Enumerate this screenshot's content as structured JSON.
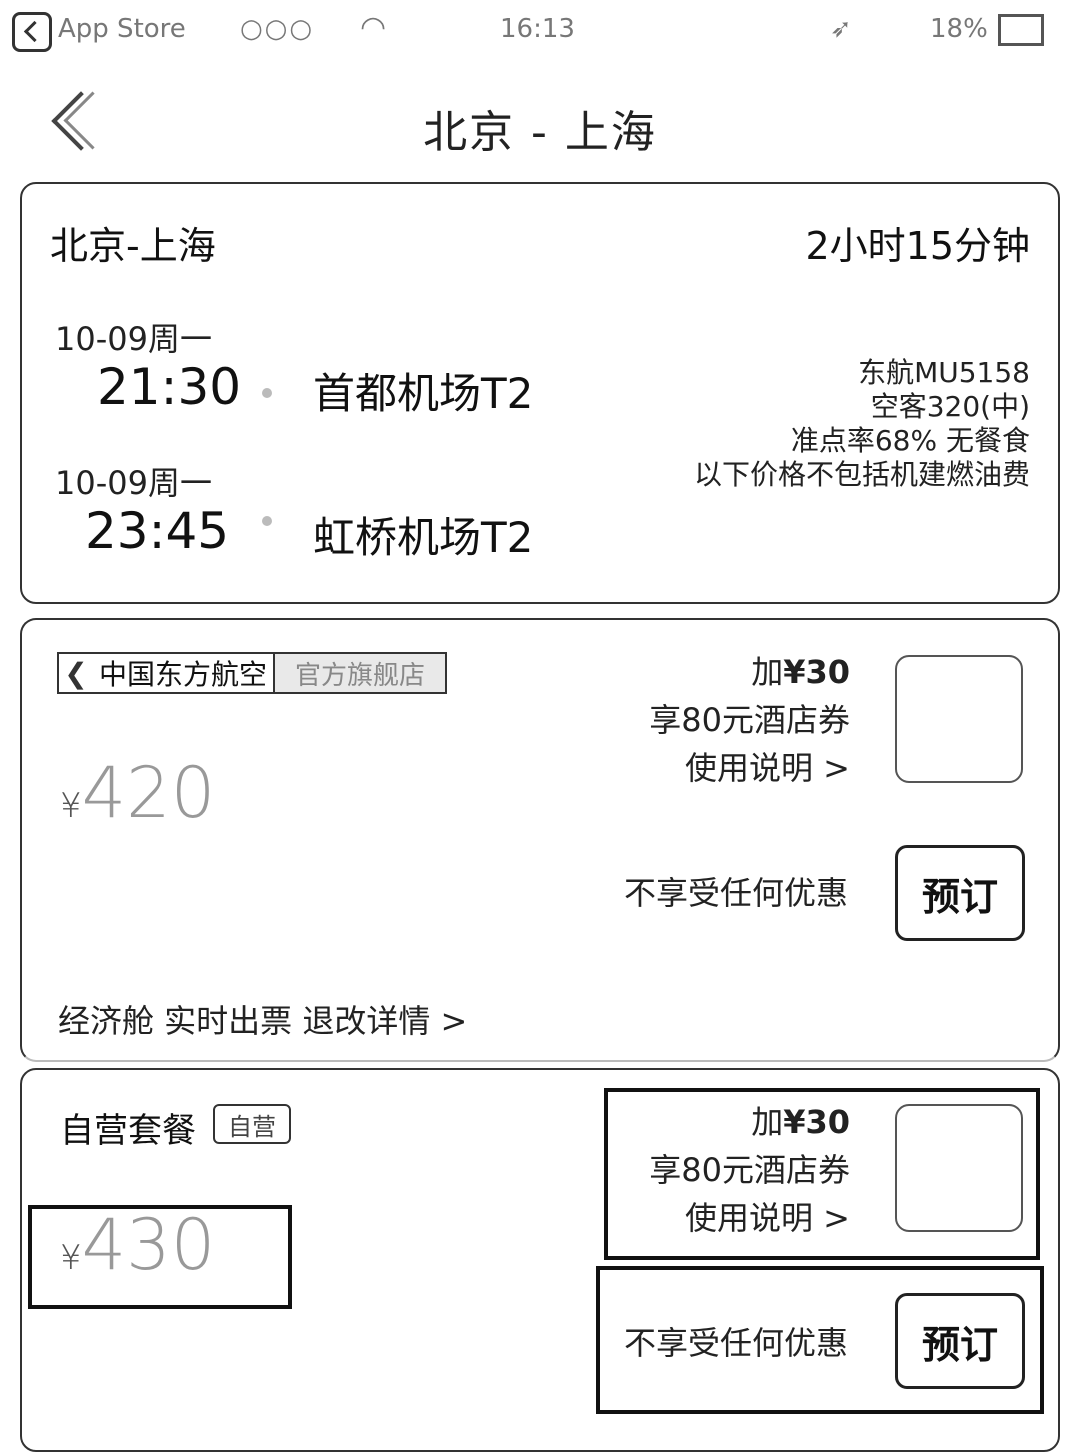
{
  "status_bar": {
    "carrier": "App Store",
    "signal": "○○○",
    "time": "16:13",
    "battery": "18%"
  },
  "nav": {
    "title": "北京 - 上海"
  },
  "flight": {
    "route": "北京-上海",
    "duration": "2小时15分钟",
    "depart_date": "10-09周一",
    "depart_time": "21:30",
    "depart_airport": "首都机场T2",
    "arrive_date": "10-09周一",
    "arrive_time": "23:45",
    "arrive_airport": "虹桥机场T2",
    "info_line1": "东航MU5158",
    "info_line2": "空客320(中)",
    "info_line3": "准点率68% 无餐食",
    "info_line4": "以下价格不包括机建燃油费"
  },
  "offer1": {
    "airline": "中国东方航空",
    "airline_tag": "官方旗舰店",
    "currency": "¥",
    "price": "420",
    "addon_prefix": "加",
    "addon_amount": "¥30",
    "addon_benefit": "享80元酒店券",
    "addon_link": "使用说明 >",
    "no_discount": "不享受任何优惠",
    "book_label": "预订",
    "footer": "经济舱 实时出票 退改详情 >"
  },
  "offer2": {
    "label": "自营套餐",
    "tag": "自营",
    "currency": "¥",
    "price": "430",
    "addon_prefix": "加",
    "addon_amount": "¥30",
    "addon_benefit": "享80元酒店券",
    "addon_link": "使用说明 >",
    "no_discount": "不享受任何优惠",
    "book_label": "预订"
  }
}
